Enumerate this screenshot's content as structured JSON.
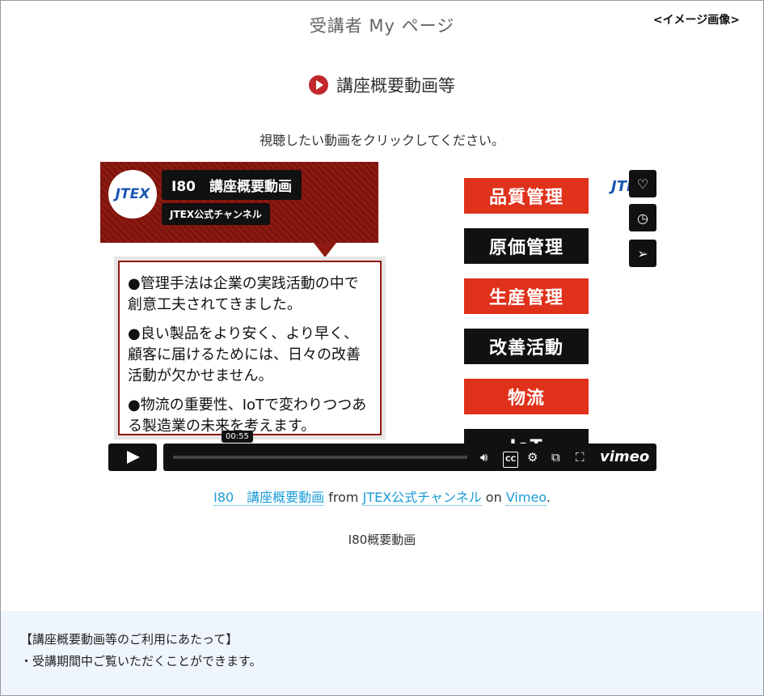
{
  "header": {
    "title": "受講者 My ページ",
    "image_note": "<イメージ画像>"
  },
  "section": {
    "heading": "講座概要動画等",
    "instruction": "視聴したい動画をクリックしてください。"
  },
  "video": {
    "title": "I80　講座概要動画",
    "channel": "JTEX公式チャンネル",
    "logo_text": "JTEX",
    "bullets": [
      "●管理手法は企業の実践活動の中で創意工夫されてきました。",
      "●良い製品をより安く、より早く、顧客に届けるためには、日々の改善活動が欠かせません。",
      "●物流の重要性、IoTで変わりつつある製造業の未来を考えます。"
    ],
    "labels": [
      {
        "text": "品質管理",
        "color": "#e0311b"
      },
      {
        "text": "原価管理",
        "color": "#111111"
      },
      {
        "text": "生産管理",
        "color": "#e0311b"
      },
      {
        "text": "改善活動",
        "color": "#111111"
      },
      {
        "text": "物流",
        "color": "#e0311b"
      },
      {
        "text": "IoT",
        "color": "#111111"
      }
    ],
    "side_buttons": [
      {
        "icon": "heart-icon",
        "glyph": "♡"
      },
      {
        "icon": "clock-icon",
        "glyph": "◷"
      },
      {
        "icon": "send-icon",
        "glyph": "➢"
      }
    ],
    "time": "00:55",
    "progress": 0,
    "brand": "vimeo"
  },
  "credit": {
    "video_link": "I80　講座概要動画",
    "from": "from",
    "channel_link": "JTEX公式チャンネル",
    "on": "on",
    "site_link": "Vimeo",
    "period": "."
  },
  "caption": "I80概要動画",
  "notice": {
    "title": "【講座概要動画等のご利用にあたって】",
    "items": [
      "・受講期間中ご覧いただくことができます。"
    ]
  },
  "colors": {
    "accent_red": "#c0282d",
    "link_blue": "#1a9bd7",
    "notice_bg": "#eef5fc"
  }
}
